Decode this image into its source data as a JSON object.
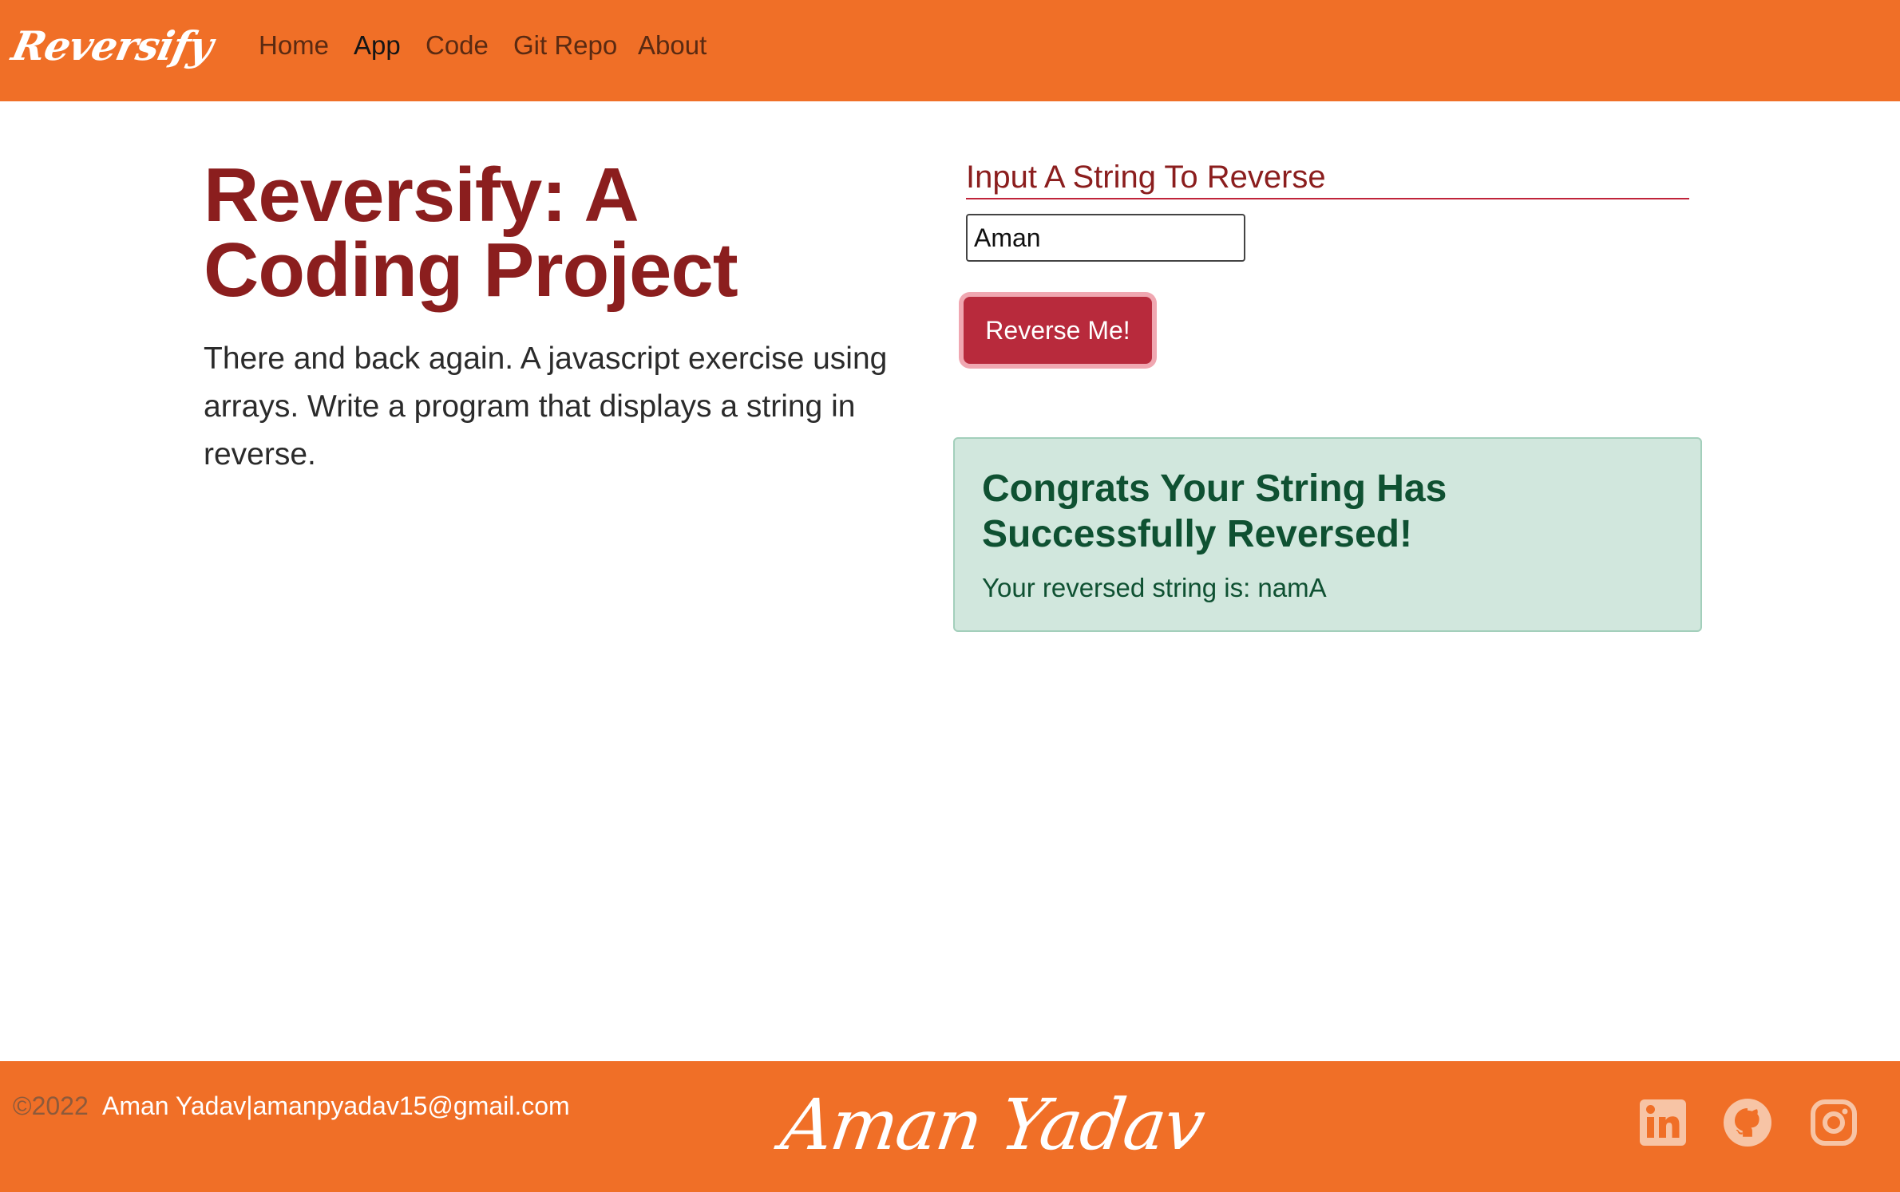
{
  "nav": {
    "brand": "Reversify",
    "links": [
      "Home",
      "App",
      "Code",
      "Git Repo",
      "About"
    ],
    "active": "App"
  },
  "hero": {
    "title": "Reversify: A Coding Project",
    "description": "There and back again. A javascript exercise using arrays. Write a program that displays a string in reverse."
  },
  "form": {
    "label": "Input A String To Reverse",
    "input_value": "Aman",
    "button_label": "Reverse Me!"
  },
  "result": {
    "heading": "Congrats Your String Has Successfully Reversed!",
    "message": "Your reversed string is: namA"
  },
  "footer": {
    "copyright": "©2022",
    "author": "Aman Yadav|amanpyadav15@gmail.com",
    "signature": "Aman Yadav",
    "social_icons": [
      "linkedin-icon",
      "github-icon",
      "instagram-icon"
    ]
  },
  "colors": {
    "brand_orange": "#f06f27",
    "title_red": "#8b1e1e",
    "button_red": "#b82a3c",
    "success_bg": "#d1e7dd",
    "success_text": "#0f5132"
  }
}
